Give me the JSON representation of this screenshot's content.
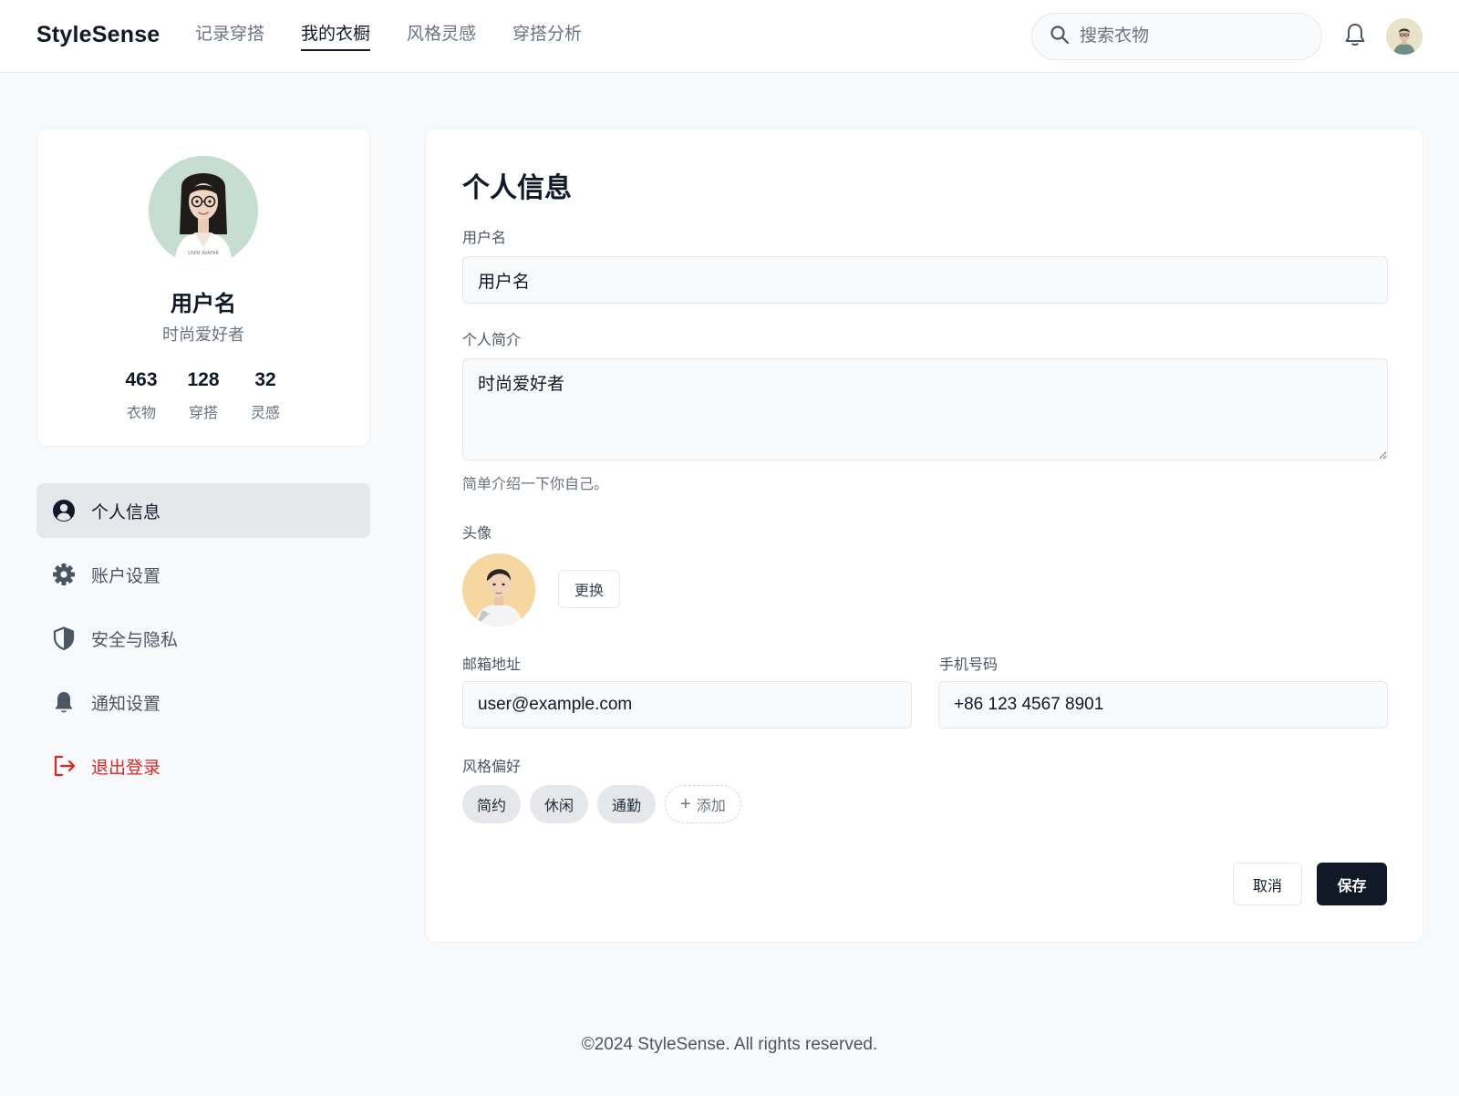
{
  "header": {
    "brand": "StyleSense",
    "nav": [
      "记录穿搭",
      "我的衣橱",
      "风格灵感",
      "穿搭分析"
    ],
    "active_nav": 1,
    "search_placeholder": "搜索衣物",
    "icons": {
      "search": "search-icon",
      "notifications": "bell-icon"
    }
  },
  "profile": {
    "name": "用户名",
    "bio": "时尚爱好者",
    "avatar_caption": "USER AVATAR",
    "stats": [
      {
        "value": "463",
        "label": "衣物"
      },
      {
        "value": "128",
        "label": "穿搭"
      },
      {
        "value": "32",
        "label": "灵感"
      }
    ]
  },
  "menu": {
    "items": [
      {
        "label": "个人信息",
        "icon": "user-circle-icon",
        "active": true
      },
      {
        "label": "账户设置",
        "icon": "gear-icon"
      },
      {
        "label": "安全与隐私",
        "icon": "shield-icon"
      },
      {
        "label": "通知设置",
        "icon": "bell-icon"
      },
      {
        "label": "退出登录",
        "icon": "logout-icon",
        "danger": true
      }
    ],
    "danger_color": "#dc2626"
  },
  "form": {
    "title": "个人信息",
    "username_label": "用户名",
    "username_value": "用户名",
    "bio_label": "个人简介",
    "bio_value": "时尚爱好者",
    "bio_help": "简单介绍一下你自己。",
    "avatar_label": "头像",
    "change_button": "更换",
    "email_label": "邮箱地址",
    "email_value": "user@example.com",
    "phone_label": "手机号码",
    "phone_value": "+86 123 4567 8901",
    "style_label": "风格偏好",
    "style_tags": [
      "简约",
      "休闲",
      "通勤"
    ],
    "add_tag_label": "添加",
    "cancel_label": "取消",
    "save_label": "保存"
  },
  "footer": {
    "text": "©2024 StyleSense. All rights reserved."
  },
  "colors": {
    "primary": "#111827",
    "background": "#f8f9fb",
    "muted": "#6b7280"
  }
}
